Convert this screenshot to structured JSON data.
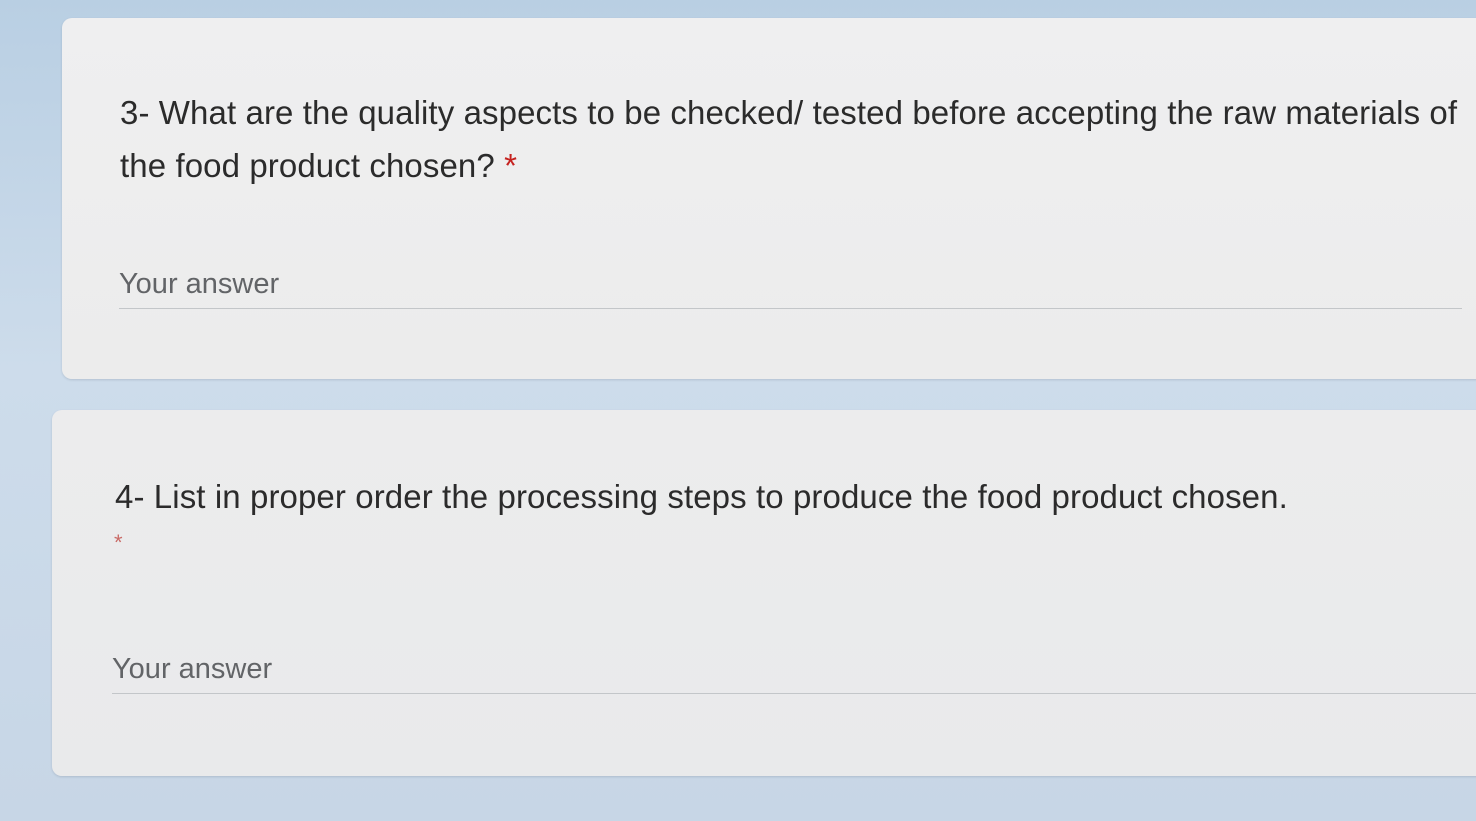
{
  "questions": [
    {
      "text": "3- What are the quality aspects to be checked/ tested before accepting the raw materials of the food product chosen?",
      "required_marker": "*",
      "answer_placeholder": "Your answer",
      "answer_value": ""
    },
    {
      "text": "4- List in proper order the processing steps to produce the food product chosen.",
      "required_marker": "*",
      "answer_placeholder": "Your answer",
      "answer_value": ""
    }
  ],
  "colors": {
    "required": "#c5221f",
    "card_background": "#eceeef",
    "page_background": "#c7d6e6"
  }
}
